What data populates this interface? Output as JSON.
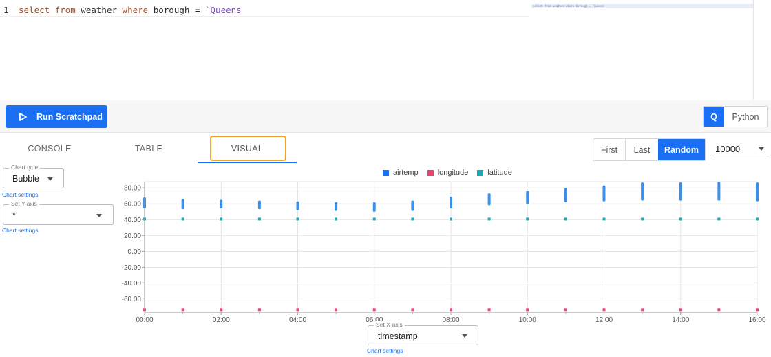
{
  "editor": {
    "line_number": "1",
    "tokens": {
      "kw1": "select",
      "kw2": "from",
      "table": "weather",
      "kw3": "where",
      "col": "borough",
      "op": "=",
      "val": "`Queens"
    },
    "minimap_text": "select from weather where borough = `Queens"
  },
  "toolbar": {
    "run_label": "Run Scratchpad",
    "lang_q": "Q",
    "lang_python": "Python"
  },
  "tabs": {
    "console": "CONSOLE",
    "table": "TABLE",
    "visual": "VISUAL"
  },
  "pager": {
    "first": "First",
    "last": "Last",
    "random": "Random",
    "row_limit": "10000"
  },
  "controls": {
    "chart_type_legend": "Chart type",
    "chart_type_value": "Bubble",
    "chart_settings_1": "Chart settings",
    "y_axis_legend": "Set Y-axis",
    "y_axis_value": "*",
    "chart_settings_2": "Chart settings",
    "x_axis_legend": "Set X-axis",
    "x_axis_value": "timestamp",
    "chart_settings_3": "Chart settings"
  },
  "colors": {
    "accent": "#1a6ff2",
    "highlight": "#f2a52a",
    "airtemp": "#2f8ae8",
    "longitude": "#e8436e",
    "latitude": "#1aa8b4"
  },
  "chart_data": {
    "type": "scatter",
    "title": "",
    "xlabel": "",
    "ylabel": "",
    "x_ticks": [
      "00:00",
      "02:00",
      "04:00",
      "06:00",
      "08:00",
      "10:00",
      "12:00",
      "14:00",
      "16:00"
    ],
    "y_ticks": [
      "80.00",
      "60.00",
      "40.00",
      "20.00",
      "0.00",
      "-20.00",
      "-40.00",
      "-60.00"
    ],
    "xlim": [
      0,
      16
    ],
    "ylim": [
      -77,
      88
    ],
    "legend": [
      "airtemp",
      "longitude",
      "latitude"
    ],
    "series": [
      {
        "name": "airtemp",
        "color": "#2f8ae8",
        "points": [
          {
            "x": 0,
            "ymin": 54,
            "ymax": 68
          },
          {
            "x": 1,
            "ymin": 53,
            "ymax": 66
          },
          {
            "x": 2,
            "ymin": 54,
            "ymax": 65
          },
          {
            "x": 3,
            "ymin": 53,
            "ymax": 64
          },
          {
            "x": 4,
            "ymin": 52,
            "ymax": 63
          },
          {
            "x": 5,
            "ymin": 51,
            "ymax": 62
          },
          {
            "x": 6,
            "ymin": 50,
            "ymax": 62
          },
          {
            "x": 7,
            "ymin": 51,
            "ymax": 64
          },
          {
            "x": 8,
            "ymin": 54,
            "ymax": 69
          },
          {
            "x": 9,
            "ymin": 58,
            "ymax": 73
          },
          {
            "x": 10,
            "ymin": 60,
            "ymax": 76
          },
          {
            "x": 11,
            "ymin": 62,
            "ymax": 80
          },
          {
            "x": 12,
            "ymin": 63,
            "ymax": 83
          },
          {
            "x": 13,
            "ymin": 64,
            "ymax": 87
          },
          {
            "x": 14,
            "ymin": 64,
            "ymax": 87
          },
          {
            "x": 15,
            "ymin": 64,
            "ymax": 88
          },
          {
            "x": 16,
            "ymin": 63,
            "ymax": 87
          }
        ]
      },
      {
        "name": "longitude",
        "color": "#e8436e",
        "points": [
          {
            "x": 0,
            "ymin": -73.8,
            "ymax": -73.8
          },
          {
            "x": 1,
            "ymin": -73.8,
            "ymax": -73.8
          },
          {
            "x": 2,
            "ymin": -73.8,
            "ymax": -73.8
          },
          {
            "x": 3,
            "ymin": -73.8,
            "ymax": -73.8
          },
          {
            "x": 4,
            "ymin": -73.8,
            "ymax": -73.8
          },
          {
            "x": 5,
            "ymin": -73.8,
            "ymax": -73.8
          },
          {
            "x": 6,
            "ymin": -73.8,
            "ymax": -73.8
          },
          {
            "x": 7,
            "ymin": -73.8,
            "ymax": -73.8
          },
          {
            "x": 8,
            "ymin": -73.8,
            "ymax": -73.8
          },
          {
            "x": 9,
            "ymin": -73.8,
            "ymax": -73.8
          },
          {
            "x": 10,
            "ymin": -73.8,
            "ymax": -73.8
          },
          {
            "x": 11,
            "ymin": -73.8,
            "ymax": -73.8
          },
          {
            "x": 12,
            "ymin": -73.8,
            "ymax": -73.8
          },
          {
            "x": 13,
            "ymin": -73.8,
            "ymax": -73.8
          },
          {
            "x": 14,
            "ymin": -73.8,
            "ymax": -73.8
          },
          {
            "x": 15,
            "ymin": -73.8,
            "ymax": -73.8
          },
          {
            "x": 16,
            "ymin": -73.8,
            "ymax": -73.8
          }
        ]
      },
      {
        "name": "latitude",
        "color": "#1aa8b4",
        "points": [
          {
            "x": 0,
            "ymin": 40.7,
            "ymax": 40.7
          },
          {
            "x": 1,
            "ymin": 40.7,
            "ymax": 40.7
          },
          {
            "x": 2,
            "ymin": 40.7,
            "ymax": 40.7
          },
          {
            "x": 3,
            "ymin": 40.7,
            "ymax": 40.7
          },
          {
            "x": 4,
            "ymin": 40.7,
            "ymax": 40.7
          },
          {
            "x": 5,
            "ymin": 40.7,
            "ymax": 40.7
          },
          {
            "x": 6,
            "ymin": 40.7,
            "ymax": 40.7
          },
          {
            "x": 7,
            "ymin": 40.7,
            "ymax": 40.7
          },
          {
            "x": 8,
            "ymin": 40.7,
            "ymax": 40.7
          },
          {
            "x": 9,
            "ymin": 40.7,
            "ymax": 40.7
          },
          {
            "x": 10,
            "ymin": 40.7,
            "ymax": 40.7
          },
          {
            "x": 11,
            "ymin": 40.7,
            "ymax": 40.7
          },
          {
            "x": 12,
            "ymin": 40.7,
            "ymax": 40.7
          },
          {
            "x": 13,
            "ymin": 40.7,
            "ymax": 40.7
          },
          {
            "x": 14,
            "ymin": 40.7,
            "ymax": 40.7
          },
          {
            "x": 15,
            "ymin": 40.7,
            "ymax": 40.7
          },
          {
            "x": 16,
            "ymin": 40.7,
            "ymax": 40.7
          }
        ]
      }
    ]
  }
}
